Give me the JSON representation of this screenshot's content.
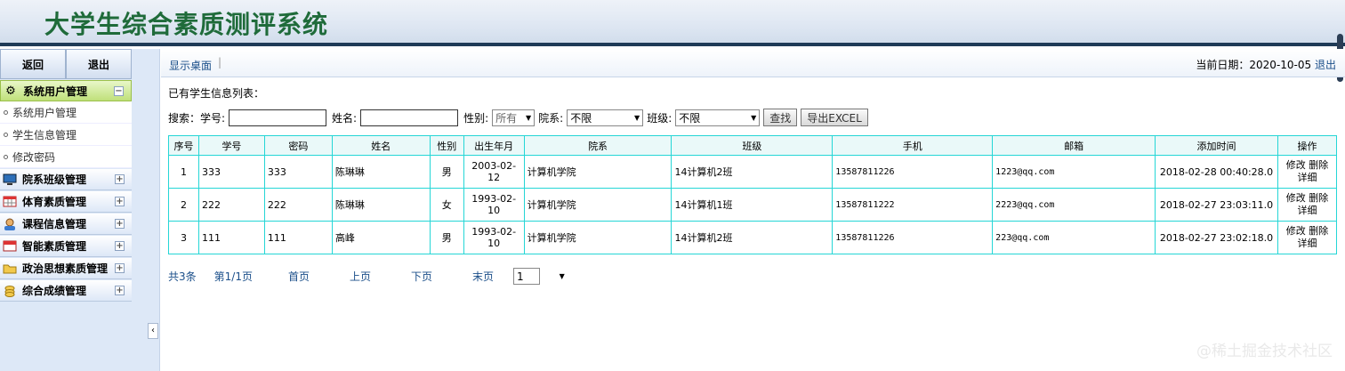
{
  "app": {
    "title": "大学生综合素质测评系统"
  },
  "sidebar": {
    "back_label": "返回",
    "exit_label": "退出",
    "groups": [
      {
        "label": "系统用户管理",
        "icon": "gear-icon",
        "expanded": true,
        "toggle": "−"
      },
      {
        "label": "院系班级管理",
        "icon": "monitor-icon",
        "toggle": "+"
      },
      {
        "label": "体育素质管理",
        "icon": "grid-icon",
        "toggle": "+"
      },
      {
        "label": "课程信息管理",
        "icon": "user-icon",
        "toggle": "+"
      },
      {
        "label": "智能素质管理",
        "icon": "calendar-icon",
        "toggle": "+"
      },
      {
        "label": "政治思想素质管理",
        "icon": "folder-icon",
        "toggle": "+"
      },
      {
        "label": "综合成绩管理",
        "icon": "coins-icon",
        "toggle": "+"
      }
    ],
    "subitems": [
      "系统用户管理",
      "学生信息管理",
      "修改密码"
    ],
    "collapse_arrow": "‹"
  },
  "topbar": {
    "nav_label": "显示桌面",
    "sep": "|",
    "date_prefix": "当前日期：2020-10-05",
    "logout_label": "退出"
  },
  "list_caption": "已有学生信息列表：",
  "search": {
    "prefix": "搜索：学号:",
    "name_label": "姓名:",
    "gender_label": "性别:",
    "gender_value": "所有",
    "dept_label": "院系:",
    "dept_value": "不限",
    "class_label": "班级:",
    "class_value": "不限",
    "search_button": "查找",
    "export_button": "导出EXCEL"
  },
  "table": {
    "headers": [
      "序号",
      "学号",
      "密码",
      "姓名",
      "性别",
      "出生年月",
      "院系",
      "班级",
      "手机",
      "邮箱",
      "添加时间",
      "操作"
    ],
    "rows": [
      [
        "1",
        "333",
        "333",
        "陈琳琳",
        "男",
        "2003-02-12",
        "计算机学院",
        "14计算机2班",
        "13587811226",
        "1223@qq.com",
        "2018-02-28 00:40:28.0"
      ],
      [
        "2",
        "222",
        "222",
        "陈琳琳",
        "女",
        "1993-02-10",
        "计算机学院",
        "14计算机1班",
        "13587811222",
        "2223@qq.com",
        "2018-02-27 23:03:11.0"
      ],
      [
        "3",
        "111",
        "111",
        "高峰",
        "男",
        "1993-02-10",
        "计算机学院",
        "14计算机2班",
        "13587811226",
        "223@qq.com",
        "2018-02-27 23:02:18.0"
      ]
    ],
    "edit_label": "修改",
    "delete_label": "删除",
    "detail_label": "详细"
  },
  "pager": {
    "total": "共3条",
    "page": "第1/1页",
    "first": "首页",
    "prev": "上页",
    "next": "下页",
    "last": "末页",
    "page_select": "1"
  },
  "watermark": "@稀土掘金技术社区"
}
